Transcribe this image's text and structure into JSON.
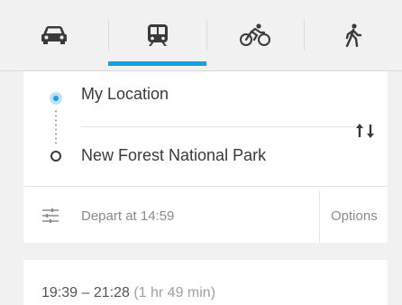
{
  "modes": [
    {
      "icon": "car-icon",
      "label": "Driving",
      "active": false
    },
    {
      "icon": "train-icon",
      "label": "Transit",
      "active": true
    },
    {
      "icon": "bicycle-icon",
      "label": "Cycling",
      "active": false
    },
    {
      "icon": "walk-icon",
      "label": "Walking",
      "active": false
    }
  ],
  "accent_color": "#1a9de1",
  "route": {
    "origin": "My Location",
    "destination": "New Forest National Park",
    "swap_icon": "swap-icon"
  },
  "options_bar": {
    "icon": "sliders-icon",
    "depart": "Depart at 14:59",
    "options_label": "Options"
  },
  "result": {
    "time_range": "19:39 – 21:28",
    "duration": "(1 hr 49 min)"
  }
}
